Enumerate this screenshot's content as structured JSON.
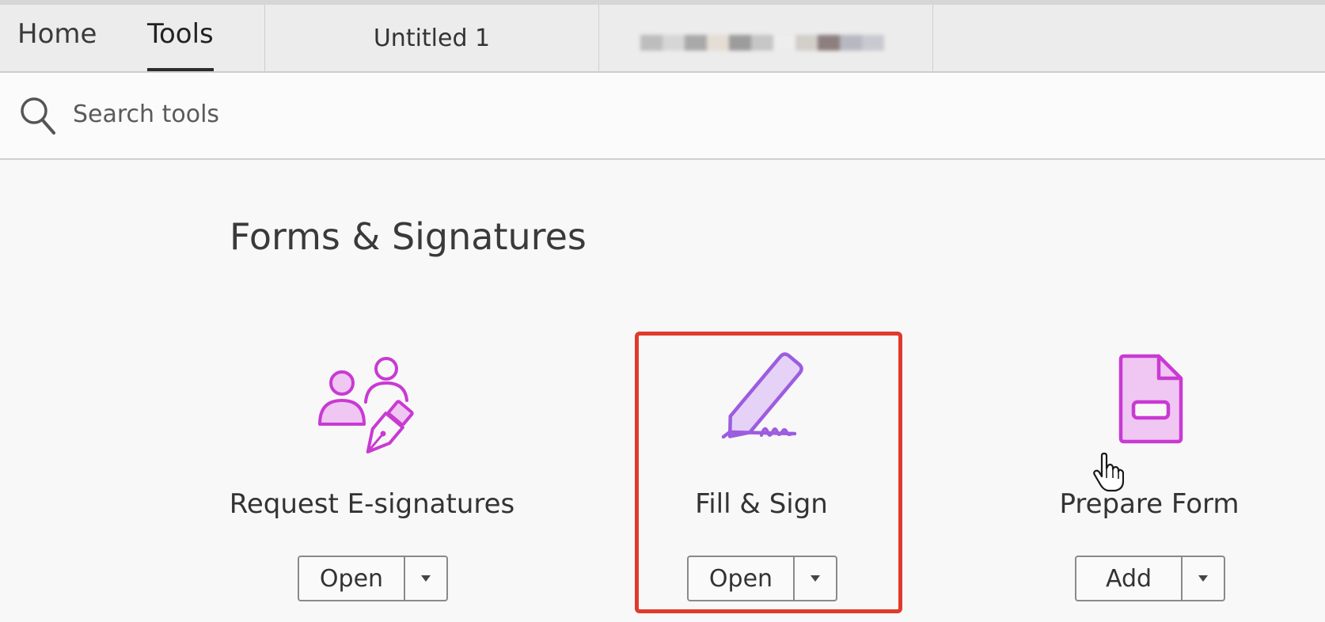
{
  "nav": {
    "home_label": "Home",
    "tools_label": "Tools",
    "active": "Tools"
  },
  "doc_tabs": [
    {
      "label": "Untitled 1"
    },
    {
      "label": ""
    }
  ],
  "search": {
    "placeholder": "Search tools",
    "value": "",
    "icon": "search-icon"
  },
  "section": {
    "title": "Forms & Signatures"
  },
  "tools": [
    {
      "label": "Request E-signatures",
      "icon": "request-esignatures-icon",
      "action_label": "Open",
      "color": "#c93ad3"
    },
    {
      "label": "Fill & Sign",
      "icon": "fill-sign-icon",
      "action_label": "Open",
      "color": "#9d5ce0"
    },
    {
      "label": "Prepare Form",
      "icon": "prepare-form-icon",
      "action_label": "Add",
      "color": "#c93ad3"
    }
  ],
  "highlight": {
    "color": "#e03a2c",
    "target": "Fill & Sign"
  }
}
